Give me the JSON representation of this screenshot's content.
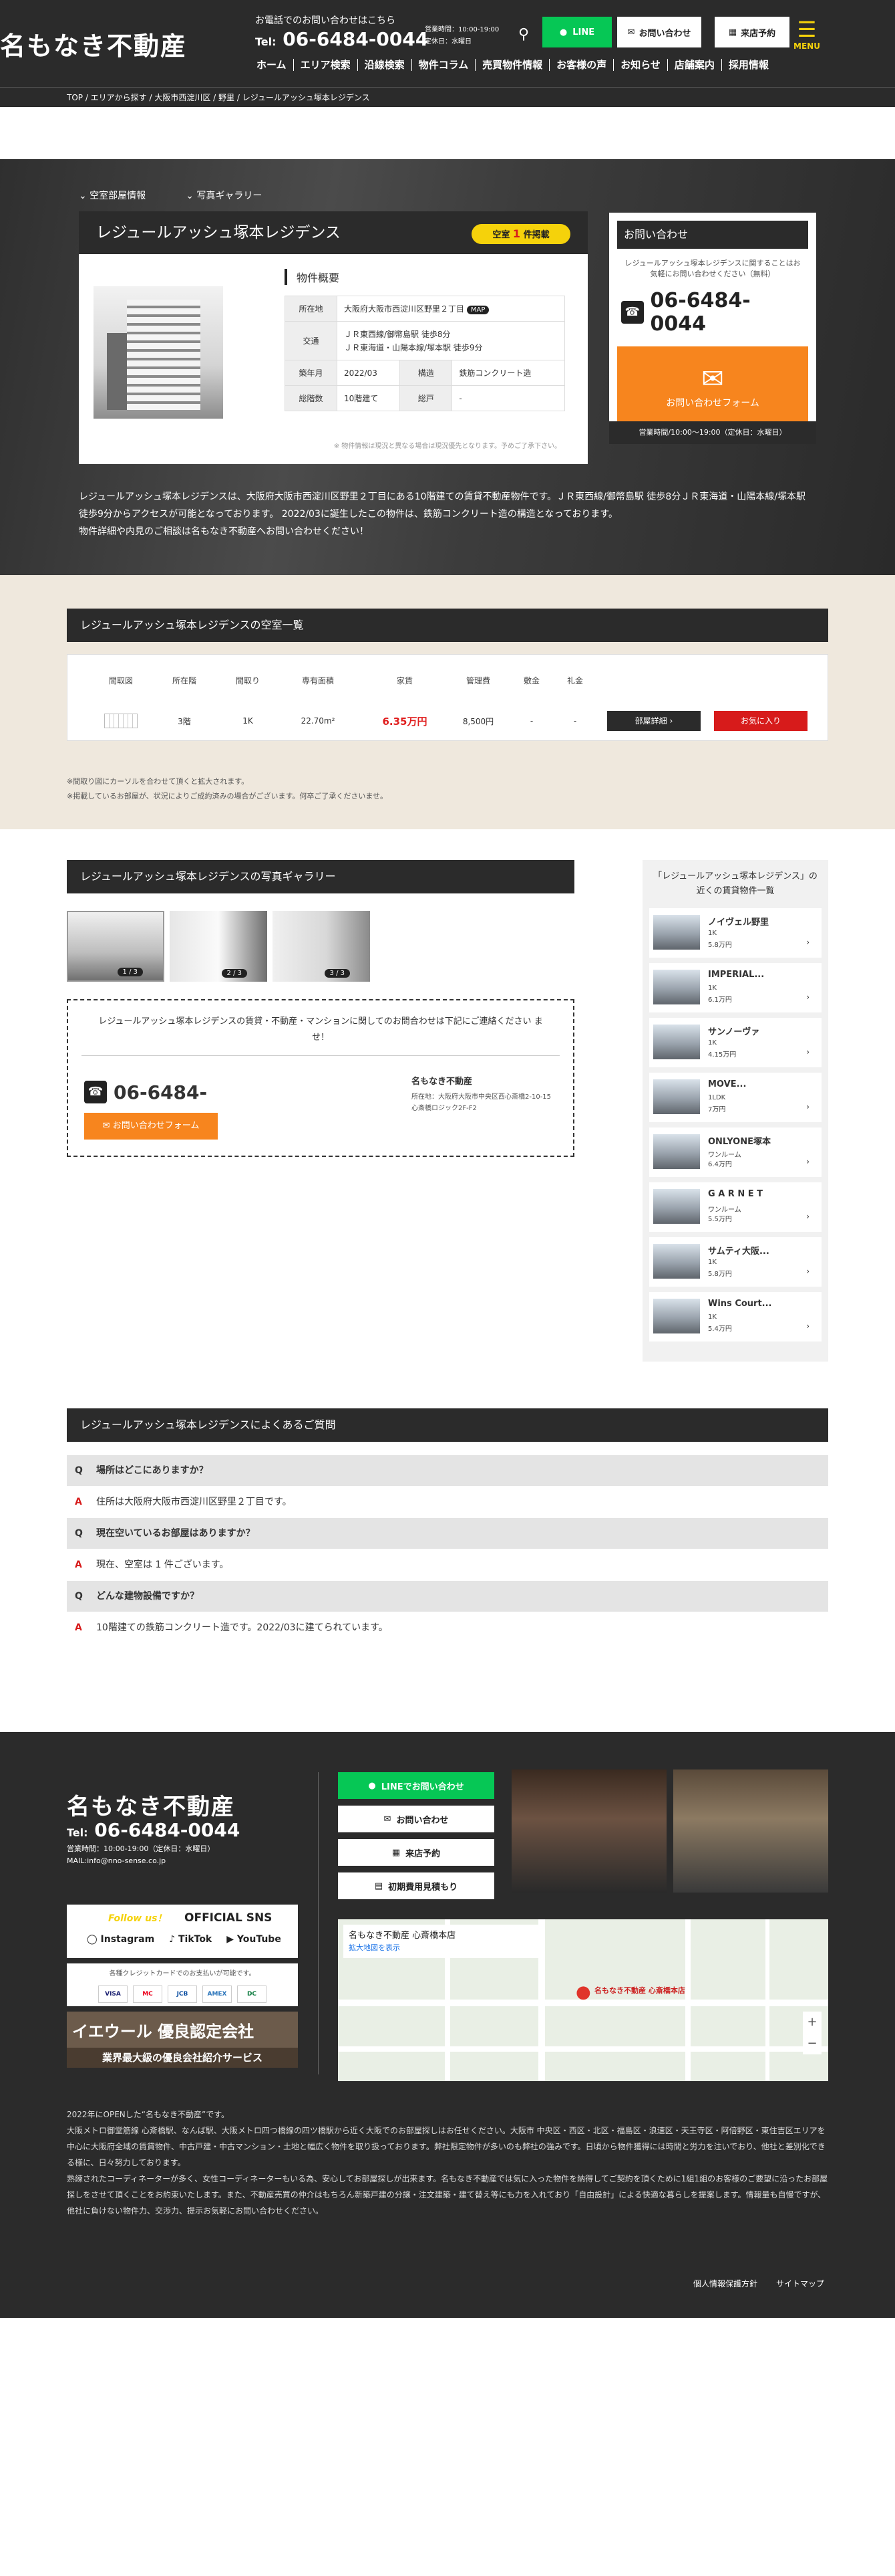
{
  "header": {
    "logo": "名もなき不動産",
    "inquiry_label": "お電話でのお問い合わせはこちら",
    "tel_prefix": "Tel:",
    "tel": "06-6484-0044",
    "hours_line1": "営業時間：10:00-19:00",
    "hours_line2": "定休日：水曜日",
    "line_label": "LINE",
    "contact_label": "お問い合わせ",
    "visit_label": "来店予約",
    "menu_label": "MENU",
    "nav": [
      "ホーム",
      "エリア検索",
      "沿線検索",
      "物件コラム",
      "売買物件情報",
      "お客様の声",
      "お知らせ",
      "店舗案内",
      "採用情報"
    ]
  },
  "breadcrumb": "TOP / エリアから探す / 大阪市西淀川区 / 野里 / レジュールアッシュ塚本レジデンス",
  "property": {
    "tab_vacancy": "空室部屋情報",
    "tab_gallery": "写真ギャラリー",
    "name": "レジュールアッシュ塚本レジデンス",
    "vacancy_prefix": "空室",
    "vacancy_count": "1",
    "vacancy_suffix": "件掲載",
    "overview_title": "物件概要",
    "overview": {
      "location_label": "所在地",
      "location": "大阪府大阪市西淀川区野里２丁目",
      "map_label": "MAP",
      "transport_label": "交通",
      "transport1": "ＪＲ東西線/御幣島駅 徒歩8分",
      "transport2": "ＪＲ東海道・山陽本線/塚本駅 徒歩9分",
      "built_label": "築年月",
      "built": "2022/03",
      "structure_label": "構造",
      "structure": "鉄筋コンクリート造",
      "floors_label": "総階数",
      "floors": "10階建て",
      "units_label": "総戸",
      "units": "-"
    },
    "note": "※ 物件情報は現況と異なる場合は現況優先となります。予めご了承下さい。",
    "description1": "レジュールアッシュ塚本レジデンスは、大阪府大阪市西淀川区野里２丁目にある10階建ての賃貸不動産物件です。ＪＲ東西線/御幣島駅 徒歩8分ＪＲ東海道・山陽本線/塚本駅",
    "description2": "徒歩9分からアクセスが可能となっております。 2022/03に誕生したこの物件は、鉄筋コンクリート造の構造となっております。",
    "description3": "物件詳細や内見のご相談は名もなき不動産へお問い合わせください！"
  },
  "inquiry_card": {
    "title": "お問い合わせ",
    "desc": "レジュールアッシュ塚本レジデンスに関することはお気軽にお問い合わせください（無料）",
    "tel": "06-6484-0044",
    "form_label": "お問い合わせフォーム",
    "hours": "営業時間/10:00～19:00（定休日：水曜日）"
  },
  "vacancy": {
    "title": "レジュールアッシュ塚本レジデンスの空室一覧",
    "headers": [
      "間取図",
      "所在階",
      "間取り",
      "専有面積",
      "家賃",
      "管理費",
      "敷金",
      "礼金"
    ],
    "row": {
      "floor": "3階",
      "layout": "1K",
      "area": "22.70m²",
      "rent": "6.35万円",
      "fee": "8,500円",
      "deposit": "-",
      "key": "-"
    },
    "detail_label": "部屋詳細",
    "fav_label": "お気に入り",
    "note1": "※間取り図にカーソルを合わせて頂くと拡大されます。",
    "note2": "※掲載しているお部屋が、状況によりご成約済みの場合がございます。何卒ご了承くださいませ。"
  },
  "gallery": {
    "title": "レジュールアッシュ塚本レジデンスの写真ギャラリー",
    "counts": [
      "1 / 3",
      "2 / 3",
      "3 / 3"
    ],
    "message": "レジュールアッシュ塚本レジデンスの賃貸・不動産・マンションに関してのお問合わせは下記にご連絡ください ませ！",
    "tel": "06-6484-",
    "form_label": "お問い合わせフォーム",
    "company": "名もなき不動産",
    "address": "所在地：大阪府大阪市中央区西心斎橋2-10-15 心斎橋ロジック2F-F2"
  },
  "nearby": {
    "title": "「レジュールアッシュ塚本レジデンス」の近くの賃貸物件一覧",
    "items": [
      {
        "name": "ノイヴェル野里",
        "layout": "1K",
        "price": "5.8万円"
      },
      {
        "name": "IMPERIAL...",
        "layout": "1K",
        "price": "6.1万円"
      },
      {
        "name": "サンノーヴァ",
        "layout": "1K",
        "price": "4.15万円"
      },
      {
        "name": "MOVE...",
        "layout": "1LDK",
        "price": "7万円"
      },
      {
        "name": "ONLYONE塚本",
        "layout": "ワンルーム",
        "price": "6.4万円"
      },
      {
        "name": "G A R N E T",
        "layout": "ワンルーム",
        "price": "5.5万円"
      },
      {
        "name": "サムティ大阪...",
        "layout": "1K",
        "price": "5.8万円"
      },
      {
        "name": "Wins Court...",
        "layout": "1K",
        "price": "5.4万円"
      }
    ]
  },
  "faq": {
    "title": "レジュールアッシュ塚本レジデンスによくあるご質問",
    "items": [
      {
        "q": "場所はどこにありますか？",
        "a": "住所は大阪府大阪市西淀川区野里２丁目です。"
      },
      {
        "q": "現在空いているお部屋はありますか？",
        "a": "現在、空室は 1 件ございます。"
      },
      {
        "q": "どんな建物設備ですか？",
        "a": "10階建ての鉄筋コンクリート造です。2022/03に建てられています。"
      }
    ]
  },
  "footer": {
    "logo": "名もなき不動産",
    "tel_prefix": "Tel:",
    "tel": "06-6484-0044",
    "hours": "営業時間：10:00-19:00（定休日：水曜日）",
    "mail": "MAIL:info@nno-sense.co.jp",
    "follow": "Follow us！",
    "official_sns": "OFFICIAL SNS",
    "sns": [
      "Instagram",
      "TikTok",
      "YouTube"
    ],
    "card_note": "各種クレジットカードでのお支払いが可能です。",
    "cards": [
      "VISA",
      "MC",
      "JCB",
      "AMEX",
      "DC"
    ],
    "banner_title": "イエウール 優良認定会社",
    "banner_sub": "業界最大級の優良会社紹介サービス",
    "btn_line": "LINEでお問い合わせ",
    "btn_contact": "お問い合わせ",
    "btn_visit": "来店予約",
    "btn_estimate": "初期費用見積もり",
    "map_title": "名もなき不動産 心斎橋本店",
    "map_link": "拡大地図を表示",
    "map_pin": "名もなき不動産 心斎橋本店",
    "text1": "2022年にOPENした“名もなき不動産”です。",
    "text2": "大阪メトロ御堂筋線 心斎橋駅、なんば駅、大阪メトロ四つ橋線の四ツ橋駅から近く大阪でのお部屋探しはお任せください。大阪市 中央区・西区・北区・福島区・浪速区・天王寺区・阿倍野区・東住吉区エリアを中心に大阪府全域の賃貸物件、中古戸建・中古マンション・土地と幅広く物件を取り扱っております。弊社限定物件が多いのも弊社の強みです。日頃から物件獲得には時間と労力を注いでおり、他社と差別化できる様に、日々努力しております。",
    "text3": "熟練されたコーディネーターが多く、女性コーディネーターもいる為、安心してお部屋探しが出来ます。名もなき不動産では気に入った物件を納得してご契約を頂くために1組1組のお客様のご要望に沿ったお部屋探しをさせて頂くことをお約束いたします。また、不動産売買の仲介はもちろん新築戸建の分譲・注文建築・建て替え等にも力を入れており「自由設計」による快適な暮らしを提案します。情報量も自慢ですが、他社に負けない物件力、交渉力、提示お気軽にお問い合わせください。",
    "privacy": "個人情報保護方針",
    "sitemap": "サイトマップ"
  }
}
